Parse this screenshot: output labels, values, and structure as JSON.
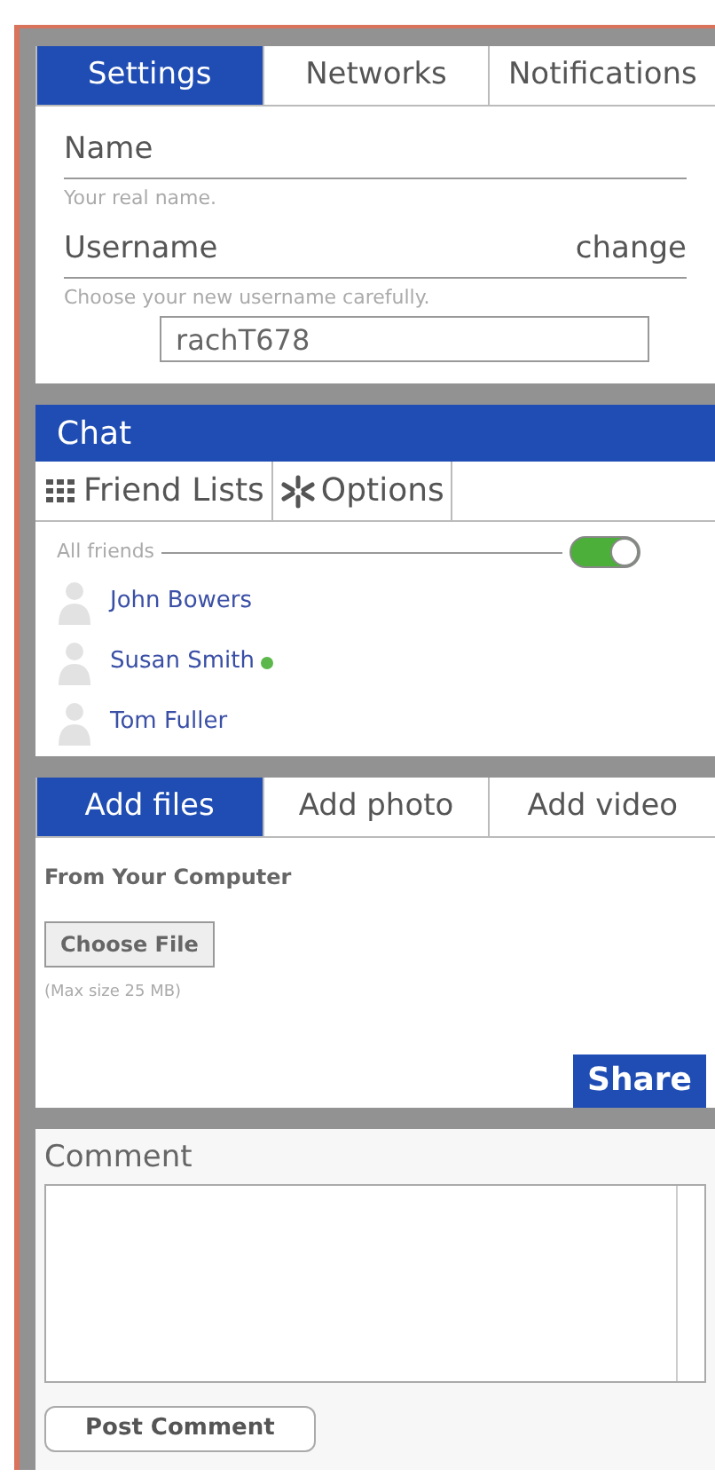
{
  "settings": {
    "tabs": [
      {
        "label": "Settings",
        "selected": true
      },
      {
        "label": "Networks",
        "selected": false
      },
      {
        "label": "Notifications",
        "selected": false
      }
    ],
    "name_label": "Name",
    "name_hint": "Your real name.",
    "username_label": "Username",
    "change_link": "change",
    "username_hint": "Choose your new username carefully.",
    "username_value": "rachT678"
  },
  "chat": {
    "title": "Chat",
    "tabs": [
      {
        "label": "Friend Lists",
        "kind": "grid"
      },
      {
        "label": "Options",
        "kind": "spark"
      }
    ],
    "all_friends_label": "All friends",
    "all_friends_on": true,
    "friends": [
      {
        "name": "John Bowers",
        "online": false
      },
      {
        "name": "Susan Smith",
        "online": true
      },
      {
        "name": "Tom Fuller",
        "online": false
      }
    ]
  },
  "upload": {
    "tabs": [
      {
        "label": "Add files",
        "selected": true
      },
      {
        "label": "Add photo",
        "selected": false
      },
      {
        "label": "Add video",
        "selected": false
      }
    ],
    "source_label": "From Your Computer",
    "choose_button": "Choose File",
    "size_note": "(Max size 25 MB)",
    "share_button": "Share"
  },
  "comment": {
    "label": "Comment",
    "post_button": "Post Comment"
  }
}
